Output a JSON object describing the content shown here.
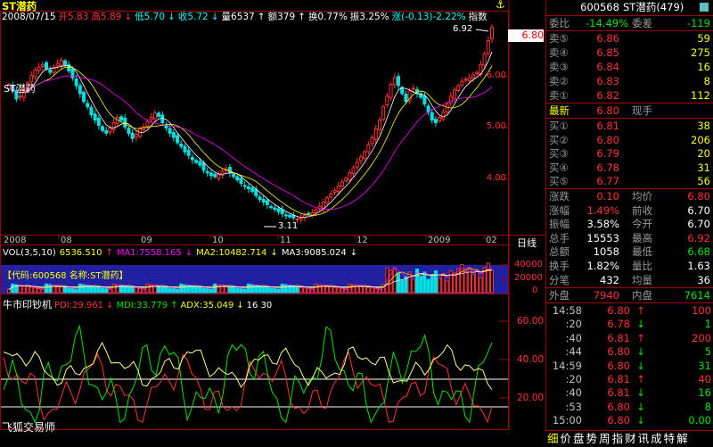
{
  "header": {
    "title": "ST潜药",
    "date": "2008/07/15",
    "open_label": "开5.83",
    "high_label": "高5.89",
    "low_label": "低5.70",
    "close_label": "收5.72",
    "vol_label": "量6537",
    "amount_label": "额379",
    "turnover_label": "换0.77%",
    "amplitude_label": "振3.25%",
    "change_label": "涨(-0.13)-2.22%",
    "indicator_label": "指数",
    "arrow_down": "↓",
    "arrow_up": "↑"
  },
  "main_chart": {
    "y_ticks": [
      "6.00",
      "5.00",
      "4.00"
    ],
    "x_labels": [
      "2008",
      "08",
      "09",
      "10",
      "11",
      "12",
      "2009",
      "02"
    ],
    "period_label": "日线",
    "low_marker": "3.11",
    "high_marker": "6.92",
    "current_price_tag": "6.80"
  },
  "volume_panel": {
    "label": "VOL(3,5,10)",
    "vol_value": "6536.510",
    "ma1": "MA1:7558.165",
    "ma2": "MA2:10482.714",
    "ma3": "MA3:9085.024",
    "ma1_arrow": "↑",
    "ma2_arrow": "↓",
    "ma3_arrow": "↓",
    "code_box": "【代码:600568 名称:ST潜药】",
    "y_ticks": [
      "40000",
      "20000",
      "0"
    ]
  },
  "indicator_panel": {
    "name": "牛市印钞机",
    "pdi": "PDI:29.961",
    "mdi": "MDI:33.779",
    "adx": "ADX:35.049",
    "params": "16 30",
    "pdi_arrow": "↓",
    "mdi_arrow": "↑",
    "adx_arrow": "↓",
    "y_ticks": [
      "60.00",
      "40.00",
      "20.00"
    ],
    "footer": "飞狐交易师"
  },
  "quote_panel": {
    "code": "600568",
    "name": "ST潜药(479)",
    "weibi_label": "委比",
    "weibi_value": "-14.49%",
    "weicha_label": "委差",
    "weicha_value": "-119",
    "asks": [
      {
        "label": "卖⑤",
        "price": "6.86",
        "vol": "59"
      },
      {
        "label": "卖④",
        "price": "6.85",
        "vol": "275"
      },
      {
        "label": "卖③",
        "price": "6.84",
        "vol": "16"
      },
      {
        "label": "卖②",
        "price": "6.83",
        "vol": "8"
      },
      {
        "label": "卖①",
        "price": "6.82",
        "vol": "112"
      }
    ],
    "last_label": "最新",
    "last_price": "6.80",
    "last_hand_label": "现手",
    "bids": [
      {
        "label": "买①",
        "price": "6.81",
        "vol": "38"
      },
      {
        "label": "买②",
        "price": "6.80",
        "vol": "206"
      },
      {
        "label": "买③",
        "price": "6.79",
        "vol": "20"
      },
      {
        "label": "买④",
        "price": "6.78",
        "vol": "31"
      },
      {
        "label": "买⑤",
        "price": "6.77",
        "vol": "56"
      }
    ],
    "stats": [
      {
        "l1": "涨跌",
        "v1": "0.10",
        "c1": "red",
        "l2": "均价",
        "v2": "6.80",
        "c2": "red"
      },
      {
        "l1": "涨幅",
        "v1": "1.49%",
        "c1": "red",
        "l2": "前收",
        "v2": "6.70",
        "c2": "wht"
      },
      {
        "l1": "振幅",
        "v1": "3.58%",
        "c1": "wht",
        "l2": "今开",
        "v2": "6.70",
        "c2": "wht"
      },
      {
        "l1": "总手",
        "v1": "15553",
        "c1": "wht",
        "l2": "最高",
        "v2": "6.92",
        "c2": "red"
      },
      {
        "l1": "总额",
        "v1": "1058",
        "c1": "wht",
        "l2": "最低",
        "v2": "6.68",
        "c2": "grn"
      },
      {
        "l1": "换手",
        "v1": "1.82%",
        "c1": "wht",
        "l2": "量比",
        "v2": "1.63",
        "c2": "wht"
      },
      {
        "l1": "分笔",
        "v1": "432",
        "c1": "wht",
        "l2": "均量",
        "v2": "36",
        "c2": "wht"
      }
    ],
    "outer_label": "外盘",
    "outer_value": "7940",
    "inner_label": "内盘",
    "inner_value": "7614",
    "ticks": [
      {
        "time": "14:58",
        "price": "6.80",
        "arrow": "↑",
        "vol": "100",
        "pc": "red",
        "ac": "red",
        "vc": "red"
      },
      {
        "time": ":20",
        "price": "6.78",
        "arrow": "↓",
        "vol": "1",
        "pc": "red",
        "ac": "grn",
        "vc": "grn"
      },
      {
        "time": ":40",
        "price": "6.81",
        "arrow": "↑",
        "vol": "200",
        "pc": "red",
        "ac": "red",
        "vc": "red"
      },
      {
        "time": ":44",
        "price": "6.80",
        "arrow": "↓",
        "vol": "5",
        "pc": "red",
        "ac": "grn",
        "vc": "grn"
      },
      {
        "time": "14:59",
        "price": "6.80",
        "arrow": "↓",
        "vol": "31",
        "pc": "red",
        "ac": "grn",
        "vc": "grn"
      },
      {
        "time": ":20",
        "price": "6.81",
        "arrow": "↑",
        "vol": "40",
        "pc": "red",
        "ac": "red",
        "vc": "red"
      },
      {
        "time": ":40",
        "price": "6.81",
        "arrow": "↓",
        "vol": "16",
        "pc": "red",
        "ac": "grn",
        "vc": "grn"
      },
      {
        "time": ":53",
        "price": "6.80",
        "arrow": "↓",
        "vol": "8",
        "pc": "red",
        "ac": "grn",
        "vc": "grn"
      },
      {
        "time": "15:00",
        "price": "6.80",
        "arrow": "↓",
        "vol": "0.00",
        "pc": "red",
        "ac": "grn",
        "vc": "grn"
      }
    ],
    "tabs": [
      "细",
      "价",
      "盘",
      "势",
      "周",
      "指",
      "财",
      "讯",
      "成",
      "特",
      "解"
    ]
  },
  "colors": {
    "up": "#ff3232",
    "down": "#00e0e0",
    "frame": "#a00000",
    "ma_white": "#ffffff",
    "ma_yellow": "#ffff00",
    "ma_magenta": "#ff00ff"
  },
  "chart_data": [
    {
      "type": "candlestick",
      "title": "ST潜药",
      "x_labels": [
        "2008",
        "08",
        "09",
        "10",
        "11",
        "12",
        "2009",
        "02"
      ],
      "ylim": [
        2.9,
        7.1
      ],
      "annotations": [
        {
          "label": "3.11",
          "value": 3.11
        },
        {
          "label": "6.92",
          "value": 6.92
        }
      ],
      "close": [
        5.72,
        5.6,
        5.45,
        5.5,
        5.62,
        5.75,
        5.9,
        6.0,
        6.05,
        6.1,
        6.02,
        5.95,
        6.05,
        6.12,
        6.18,
        6.08,
        5.98,
        5.85,
        5.7,
        5.55,
        5.4,
        5.3,
        5.15,
        5.05,
        4.95,
        4.85,
        4.8,
        4.9,
        5.0,
        5.1,
        5.05,
        4.92,
        4.8,
        4.7,
        4.78,
        4.88,
        4.92,
        5.02,
        5.1,
        5.18,
        5.12,
        5.0,
        4.9,
        4.8,
        4.72,
        4.62,
        4.55,
        4.45,
        4.38,
        4.3,
        4.25,
        4.2,
        4.1,
        4.05,
        4.0,
        3.98,
        4.02,
        4.08,
        4.12,
        4.05,
        3.98,
        3.92,
        3.85,
        3.8,
        3.75,
        3.7,
        3.62,
        3.55,
        3.5,
        3.45,
        3.4,
        3.36,
        3.32,
        3.28,
        3.25,
        3.22,
        3.2,
        3.18,
        3.2,
        3.25,
        3.28,
        3.3,
        3.35,
        3.42,
        3.5,
        3.58,
        3.65,
        3.72,
        3.8,
        3.88,
        3.95,
        4.05,
        4.15,
        4.25,
        4.35,
        4.45,
        4.58,
        4.72,
        4.88,
        5.05,
        5.3,
        5.5,
        5.72,
        5.85,
        5.7,
        5.55,
        5.4,
        5.6,
        5.65,
        5.55,
        5.48,
        5.35,
        5.2,
        5.05,
        5.0,
        5.1,
        5.2,
        5.35,
        5.5,
        5.62,
        5.7,
        5.78,
        5.82,
        5.85,
        5.9,
        5.95,
        6.1,
        6.3,
        6.55,
        6.8
      ]
    },
    {
      "type": "bar",
      "title": "VOL(3,5,10)",
      "ylim": [
        0,
        50000
      ],
      "y_ticks": [
        40000,
        20000,
        0
      ]
    },
    {
      "type": "line",
      "title": "牛市印钞机",
      "ylim": [
        5,
        72
      ],
      "y_ticks": [
        60,
        40,
        20
      ],
      "series": [
        {
          "name": "PDI",
          "last": 29.961
        },
        {
          "name": "MDI",
          "last": 33.779
        },
        {
          "name": "ADX",
          "last": 35.049
        }
      ],
      "reference_lines": [
        30,
        16
      ]
    }
  ]
}
